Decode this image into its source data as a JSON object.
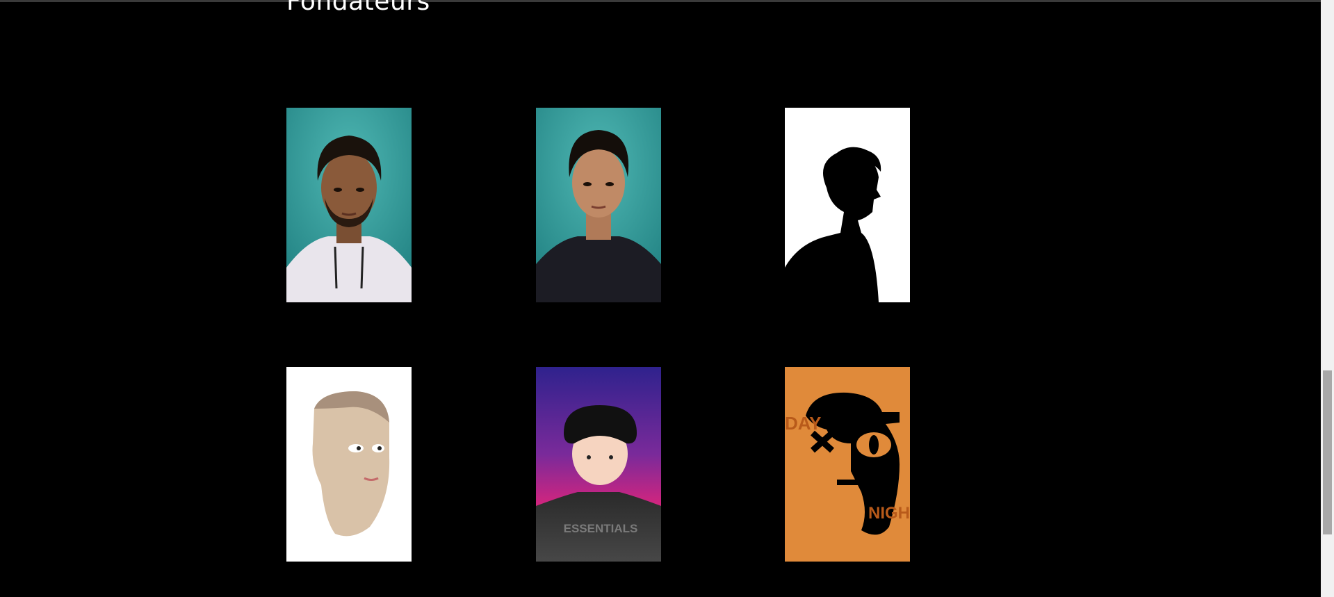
{
  "section": {
    "title": "Fondateurs"
  },
  "founders": [
    {
      "name": "founder-photo-1",
      "kind": "photo",
      "bg": "#2f9d9d"
    },
    {
      "name": "founder-photo-2",
      "kind": "photo",
      "bg": "#2f9d9d"
    },
    {
      "name": "founder-silhouette",
      "kind": "silhouette",
      "bg": "#ffffff"
    },
    {
      "name": "founder-3d-head",
      "kind": "render",
      "bg": "#ffffff"
    },
    {
      "name": "founder-cartoon-essentials",
      "kind": "cartoon",
      "bg": "#3a1f8f",
      "shirt_text": "ESSENTIALS"
    },
    {
      "name": "founder-day-night-poster",
      "kind": "poster",
      "bg": "#e08a3a",
      "text_day": "DAY",
      "text_night": "NIGHT"
    }
  ],
  "colors": {
    "background": "#000000",
    "teal": "#2f9d9d",
    "orange": "#e08a3a",
    "purple": "#3a1f8f",
    "pink": "#e0247a"
  }
}
